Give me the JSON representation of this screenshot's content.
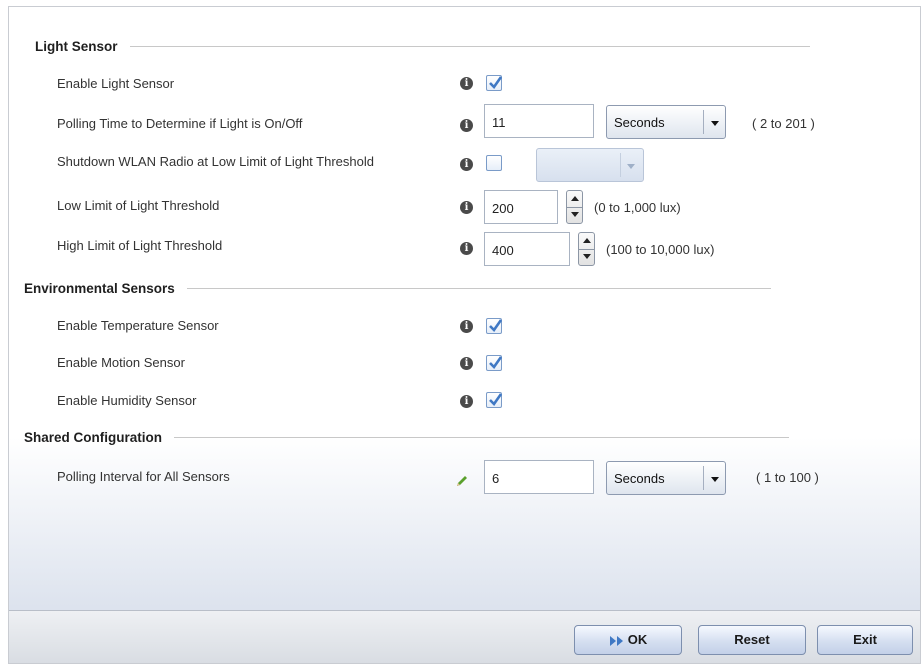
{
  "sections": {
    "light_sensor": {
      "title": "Light Sensor",
      "enable_label": "Enable Light Sensor",
      "polling_label": "Polling Time to Determine if Light is On/Off",
      "polling_value": "11",
      "polling_unit": "Seconds",
      "polling_range": "( 2 to 201 )",
      "shutdown_label": "Shutdown WLAN Radio at Low Limit of Light Threshold",
      "low_label": "Low Limit of Light Threshold",
      "low_value": "200",
      "low_range": "(0 to 1,000 lux)",
      "high_label": "High Limit of Light Threshold",
      "high_value": "400",
      "high_range": "(100 to 10,000 lux)"
    },
    "environmental": {
      "title": "Environmental Sensors",
      "temp_label": "Enable Temperature Sensor",
      "motion_label": "Enable Motion Sensor",
      "humidity_label": "Enable Humidity Sensor"
    },
    "shared": {
      "title": "Shared Configuration",
      "interval_label": "Polling Interval for All Sensors",
      "interval_value": "6",
      "interval_unit": "Seconds",
      "interval_range": "( 1 to 100 )"
    }
  },
  "checkbox_states": {
    "enable_light_sensor": true,
    "shutdown_wlan_radio": false,
    "enable_temperature_sensor": true,
    "enable_motion_sensor": true,
    "enable_humidity_sensor": true
  },
  "icons": {
    "info": "info-icon",
    "pencil": "pencil-icon",
    "check": "check-icon",
    "ok": "ok-arrow-icon"
  },
  "footer": {
    "ok_label": "OK",
    "reset_label": "Reset",
    "exit_label": "Exit"
  },
  "colors": {
    "check": "#3f78c4",
    "pencil": "#5aa02c",
    "ok_arrow": "#3f78c4"
  }
}
